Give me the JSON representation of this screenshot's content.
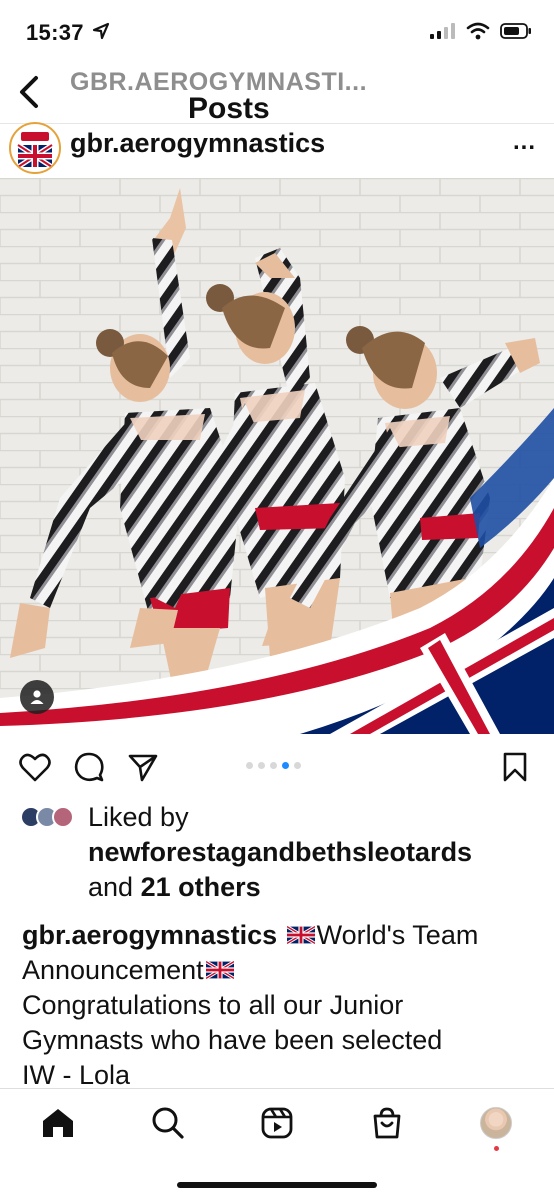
{
  "status_bar": {
    "time": "15:37",
    "icons": [
      "location-arrow-icon",
      "signal-icon",
      "wifi-icon",
      "battery-icon"
    ]
  },
  "nav": {
    "title": "GBR.AEROGYMNASTI...",
    "subtitle": "Posts"
  },
  "post": {
    "username": "gbr.aerogymnastics",
    "more": "...",
    "carousel": {
      "count": 5,
      "active_index": 3
    },
    "likes": {
      "prefix": "Liked by",
      "liker": "newforestagandbethsleotards",
      "and": "and",
      "others": "21 others"
    },
    "caption": {
      "username": "gbr.aerogymnastics",
      "part1": "World's Team",
      "part2": "Announcement",
      "line3": "Congratulations to all our Junior",
      "line4": "Gymnasts who have been selected",
      "line5": "IW - Lola"
    }
  },
  "tabbar": {
    "items": [
      "home-icon",
      "search-icon",
      "reels-icon",
      "shop-icon",
      "profile-avatar"
    ]
  },
  "colors": {
    "flag_red": "#c8102e",
    "flag_blue": "#012169",
    "active_dot": "#1a8cff",
    "avatar_ring": "#e6a23a"
  }
}
